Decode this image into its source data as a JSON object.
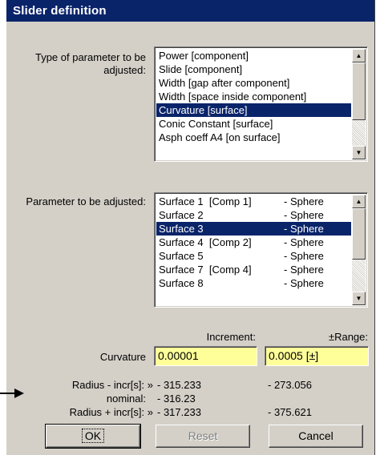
{
  "window": {
    "title": "Slider definition"
  },
  "type_section": {
    "label": "Type of parameter to be adjusted:",
    "items": [
      "Power [component]",
      "Slide [component]",
      "Width [gap after component]",
      "Width [space inside component]",
      "Curvature [surface]",
      "Conic Constant [surface]",
      "Asph coeff A4 [on surface]"
    ],
    "selected_index": 4
  },
  "param_section": {
    "label": "Parameter to be adjusted:",
    "items": [
      {
        "name": "Surface 1  [Comp 1]",
        "type": "- Sphere"
      },
      {
        "name": "Surface 2",
        "type": "- Sphere"
      },
      {
        "name": "Surface 3",
        "type": "- Sphere"
      },
      {
        "name": "Surface 4  [Comp 2]",
        "type": "- Sphere"
      },
      {
        "name": "Surface 5",
        "type": "- Sphere"
      },
      {
        "name": "Surface 7  [Comp 4]",
        "type": "- Sphere"
      },
      {
        "name": "Surface 8",
        "type": "- Sphere"
      }
    ],
    "selected_index": 2
  },
  "columns": {
    "increment": "Increment:",
    "range": "±Range:"
  },
  "curvature": {
    "label": "Curvature",
    "increment_value": "0.00001",
    "range_value": "0.0005 [±]"
  },
  "radius": {
    "minus_label": "Radius - incr[s]: »",
    "minus_inc": "- 315.233",
    "minus_range": "- 273.056",
    "nominal_label": "nominal:",
    "nominal_value": "- 316.23",
    "plus_label": "Radius + incr[s]: »",
    "plus_inc": "- 317.233",
    "plus_range": "- 375.621"
  },
  "buttons": {
    "ok": "OK",
    "reset": "Reset",
    "cancel": "Cancel"
  },
  "icons": {
    "pointer": "arrow-right-icon",
    "scroll_up": "scroll-up-icon",
    "scroll_down": "scroll-down-icon"
  }
}
